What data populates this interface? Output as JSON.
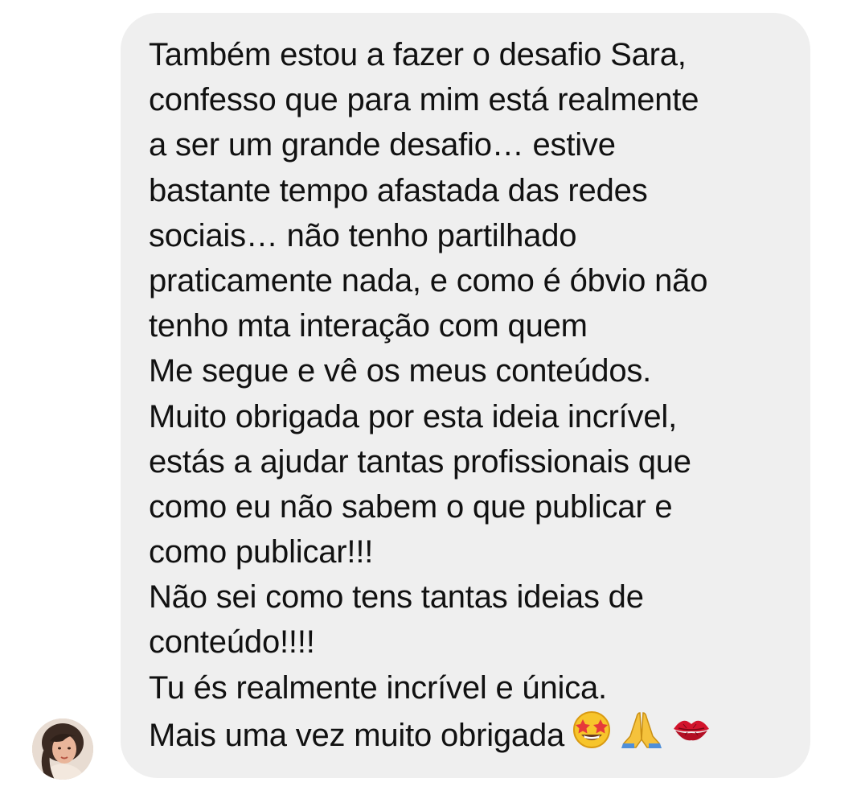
{
  "conversation": {
    "message": {
      "lines": [
        "Também estou a fazer o desafio Sara,",
        "confesso que para mim está realmente",
        "a ser um grande desafio… estive",
        "bastante tempo afastada das redes",
        "sociais… não tenho partilhado",
        "praticamente nada, e como é óbvio não",
        "tenho mta interação com quem",
        "Me segue e vê os meus conteúdos.",
        "Muito obrigada por esta ideia incrível,",
        "estás a ajudar tantas profissionais que",
        "como eu não sabem o que publicar e",
        "como publicar!!!",
        "Não sei como tens tantas ideias de",
        "conteúdo!!!!",
        "Tu és realmente incrível e única.",
        "Mais uma vez muito obrigada"
      ],
      "emojis": [
        "star-struck-face-icon",
        "folded-hands-icon",
        "kiss-mark-icon"
      ]
    },
    "sender": {
      "avatar_icon": "user-avatar-photo"
    }
  },
  "colors": {
    "bubble_background": "#efefef",
    "text": "#111111",
    "page_background": "#ffffff"
  }
}
